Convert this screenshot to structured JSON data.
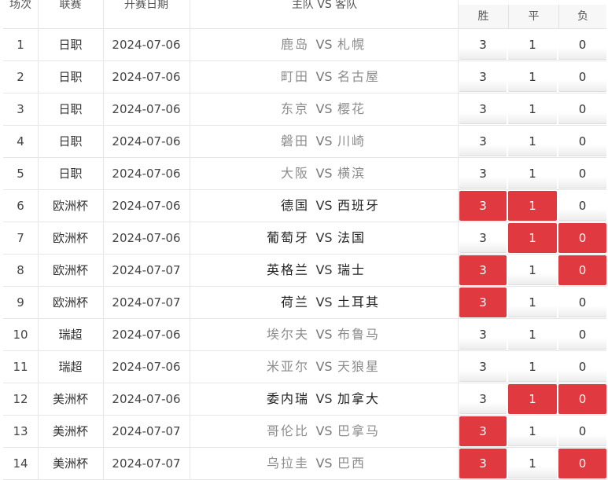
{
  "header": {
    "col_num": "场次",
    "col_league": "联赛",
    "col_date": "开赛日期",
    "col_match": "主队 VS 客队",
    "col_win": "胜",
    "col_draw": "平",
    "col_lose": "负"
  },
  "vs_label": "VS",
  "colors": {
    "highlight": "#e0393f",
    "muted_team": "#8c8c8c"
  },
  "rows": [
    {
      "num": "1",
      "league": "日职",
      "date": "2024-07-06",
      "home": "鹿岛",
      "away": "札幌",
      "win": "3",
      "draw": "1",
      "lose": "0",
      "hit": [
        false,
        false,
        false
      ],
      "home_muted": true,
      "away_muted": true
    },
    {
      "num": "2",
      "league": "日职",
      "date": "2024-07-06",
      "home": "町田",
      "away": "名古屋",
      "win": "3",
      "draw": "1",
      "lose": "0",
      "hit": [
        false,
        false,
        false
      ],
      "home_muted": true,
      "away_muted": true
    },
    {
      "num": "3",
      "league": "日职",
      "date": "2024-07-06",
      "home": "东京",
      "away": "樱花",
      "win": "3",
      "draw": "1",
      "lose": "0",
      "hit": [
        false,
        false,
        false
      ],
      "home_muted": true,
      "away_muted": true
    },
    {
      "num": "4",
      "league": "日职",
      "date": "2024-07-06",
      "home": "磐田",
      "away": "川崎",
      "win": "3",
      "draw": "1",
      "lose": "0",
      "hit": [
        false,
        false,
        false
      ],
      "home_muted": true,
      "away_muted": true
    },
    {
      "num": "5",
      "league": "日职",
      "date": "2024-07-06",
      "home": "大阪",
      "away": "横滨",
      "win": "3",
      "draw": "1",
      "lose": "0",
      "hit": [
        false,
        false,
        false
      ],
      "home_muted": true,
      "away_muted": true
    },
    {
      "num": "6",
      "league": "欧洲杯",
      "date": "2024-07-06",
      "home": "德国",
      "away": "西班牙",
      "win": "3",
      "draw": "1",
      "lose": "0",
      "hit": [
        true,
        true,
        false
      ],
      "home_muted": false,
      "away_muted": false
    },
    {
      "num": "7",
      "league": "欧洲杯",
      "date": "2024-07-06",
      "home": "葡萄牙",
      "away": "法国",
      "win": "3",
      "draw": "1",
      "lose": "0",
      "hit": [
        false,
        true,
        true
      ],
      "home_muted": false,
      "away_muted": false
    },
    {
      "num": "8",
      "league": "欧洲杯",
      "date": "2024-07-07",
      "home": "英格兰",
      "away": "瑞士",
      "win": "3",
      "draw": "1",
      "lose": "0",
      "hit": [
        true,
        false,
        true
      ],
      "home_muted": false,
      "away_muted": false
    },
    {
      "num": "9",
      "league": "欧洲杯",
      "date": "2024-07-07",
      "home": "荷兰",
      "away": "土耳其",
      "win": "3",
      "draw": "1",
      "lose": "0",
      "hit": [
        true,
        false,
        false
      ],
      "home_muted": false,
      "away_muted": false
    },
    {
      "num": "10",
      "league": "瑞超",
      "date": "2024-07-06",
      "home": "埃尔夫",
      "away": "布鲁马",
      "win": "3",
      "draw": "1",
      "lose": "0",
      "hit": [
        false,
        false,
        false
      ],
      "home_muted": true,
      "away_muted": true
    },
    {
      "num": "11",
      "league": "瑞超",
      "date": "2024-07-06",
      "home": "米亚尔",
      "away": "天狼星",
      "win": "3",
      "draw": "1",
      "lose": "0",
      "hit": [
        false,
        false,
        false
      ],
      "home_muted": true,
      "away_muted": true
    },
    {
      "num": "12",
      "league": "美洲杯",
      "date": "2024-07-06",
      "home": "委内瑞",
      "away": "加拿大",
      "win": "3",
      "draw": "1",
      "lose": "0",
      "hit": [
        false,
        true,
        true
      ],
      "home_muted": false,
      "away_muted": false
    },
    {
      "num": "13",
      "league": "美洲杯",
      "date": "2024-07-07",
      "home": "哥伦比",
      "away": "巴拿马",
      "win": "3",
      "draw": "1",
      "lose": "0",
      "hit": [
        true,
        false,
        false
      ],
      "home_muted": true,
      "away_muted": true
    },
    {
      "num": "14",
      "league": "美洲杯",
      "date": "2024-07-07",
      "home": "乌拉圭",
      "away": "巴西",
      "win": "3",
      "draw": "1",
      "lose": "0",
      "hit": [
        true,
        false,
        true
      ],
      "home_muted": true,
      "away_muted": true
    }
  ]
}
